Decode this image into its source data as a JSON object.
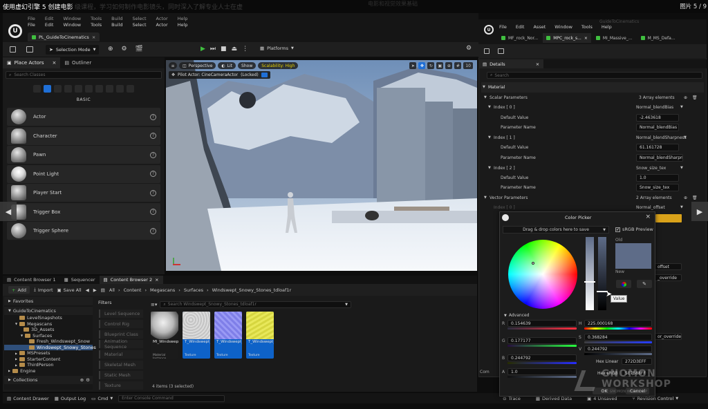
{
  "overlay": {
    "caption": "使用虚幻引擎 5 创建电影",
    "caption_tail": "级课程，学习如何制作电影镜头，同时深入了解专业人士在虚",
    "center_faint": "电影和视觉效果基础",
    "pager": "图片 5 / 9",
    "watermark": "GNOMON WORKSHOP",
    "watermark_sub": "THE GNOMON WORKSHOP"
  },
  "main_editor": {
    "menu": [
      "File",
      "Edit",
      "Window",
      "Tools",
      "Build",
      "Select",
      "Actor",
      "Help"
    ],
    "level_tab": "PL_GuideToCinematics",
    "toolbar": {
      "selection_mode": "Selection Mode",
      "platforms": "Platforms"
    },
    "place_actors": {
      "tab_label": "Place Actors",
      "outliner_label": "Outliner",
      "search_placeholder": "Search Classes",
      "category": "BASIC",
      "items": [
        "Actor",
        "Character",
        "Pawn",
        "Point Light",
        "Player Start",
        "Trigger Box",
        "Trigger Sphere"
      ]
    },
    "viewport": {
      "perspective": "Perspective",
      "lit": "Lit",
      "show": "Show",
      "scalability": "Scalability: High",
      "pilot": "Pilot Actor: CineCameraActor",
      "locked": "(Locked)",
      "fov": "10"
    }
  },
  "content_browser": {
    "tabs": [
      "Content Browser 1",
      "Sequencer",
      "Content Browser 2"
    ],
    "add": "Add",
    "import": "Import",
    "save_all": "Save All",
    "breadcrumb": [
      "All",
      "Content",
      "Megascans",
      "Surfaces",
      "Windswept_Snowy_Stones_tdloaf1r"
    ],
    "favorites": "Favorites",
    "root": "GuideToCinematics",
    "tree": [
      "LevelSnapshots",
      "Megascans",
      "3D_Assets",
      "Surfaces",
      "Fresh_Windswept_Snow",
      "Windswept_Snowy_Stones",
      "MSPresets",
      "StarterContent",
      "ThirdPerson",
      "Engine"
    ],
    "collections": "Collections",
    "filters_label": "Filters",
    "filters": [
      "Level Sequence",
      "Control Rig",
      "Blueprint Class",
      "Animation Sequence",
      "Material",
      "Skeletal Mesh",
      "Static Mesh",
      "Texture"
    ],
    "search_placeholder": "Search Windswept_Snowy_Stones_tdloaf1r",
    "assets": [
      {
        "name": "MI_Windswept_",
        "type": "Material Instance"
      },
      {
        "name": "T_Windswept_Snowy_",
        "type": "Texture"
      },
      {
        "name": "T_Windswept_Snowy_",
        "type": "Texture"
      },
      {
        "name": "T_Windswept_SnowyStones_",
        "type": "Texture"
      }
    ],
    "status": "4 items (3 selected)"
  },
  "bottom_bar": {
    "content_drawer": "Content Drawer",
    "output_log": "Output Log",
    "cmd": "Cmd",
    "console_placeholder": "Enter Console Command",
    "trace": "Trace",
    "derived_data": "Derived Data",
    "unsaved": "4 Unsaved",
    "revision_control": "Revision Control"
  },
  "material_editor": {
    "menu": [
      "File",
      "Edit",
      "Asset",
      "Window",
      "Tools",
      "Help"
    ],
    "title_faint": "GuideToCinematics",
    "tabs": [
      "MF_rock_Nor...",
      "MPC_rock_s...",
      "MI_Massive_...",
      "M_MS_Defa..."
    ],
    "details_tab": "Details",
    "search_placeholder": "Search",
    "section": "Material",
    "scalar_parameters": "Scalar Parameters",
    "scalar_count": "3 Array elements",
    "indices": [
      {
        "index": "Index [ 0 ]",
        "param": "Normal_blendBias",
        "value": "-2.463618",
        "name": "Normal_blendBias"
      },
      {
        "index": "Index [ 1 ]",
        "param": "Normal_blendSharpness",
        "value": "61.161728",
        "name": "Normal_blendSharpness"
      },
      {
        "index": "Index [ 2 ]",
        "param": "Snow_size_tex",
        "value": "1.0",
        "name": "Snow_size_tex"
      }
    ],
    "default_value": "Default Value",
    "parameter_name": "Parameter Name",
    "vector_parameters": "Vector Parameters",
    "vector_count": "2 Array elements",
    "vector_index": "Index [ 0 ]",
    "vector_param": "Normal_offset",
    "peek_offset": "offset",
    "peek_override": "_override",
    "peek_override2": "or_override",
    "bottom_label": "Com"
  },
  "color_picker": {
    "title": "Color Picker",
    "drag_hint": "Drag & drop colors here to save",
    "srgb_preview": "sRGB Preview",
    "old": "Old",
    "new": "New",
    "tooltip": "Value",
    "advanced": "Advanced",
    "r": "0.154639",
    "g": "0.177177",
    "b": "0.244792",
    "a": "1.0",
    "h": "225.000168",
    "s": "0.368284",
    "v": "0.244792",
    "hex_linear_label": "Hex Linear",
    "hex_linear": "272D3EFF",
    "hex_srgb_label": "Hex sRGB",
    "hex_srgb": "5E7588FF",
    "ok": "OK",
    "cancel": "Cancel",
    "labels": {
      "r": "R",
      "g": "G",
      "b": "B",
      "a": "A",
      "h": "H",
      "s": "S",
      "v": "V"
    },
    "colors": {
      "old": "#5e6c88",
      "new": "#5e6c88"
    }
  },
  "colors": {
    "accent_blue": "#0e62c8",
    "play_green": "#3fbf3f",
    "scalability_yellow": "#e6d200",
    "param_yellow": "#d9a21a"
  }
}
